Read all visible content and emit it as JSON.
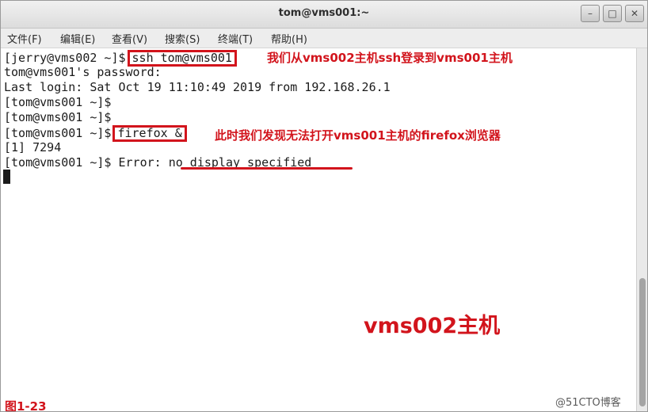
{
  "window": {
    "title": "tom@vms001:~",
    "min_glyph": "–",
    "max_glyph": "□",
    "close_glyph": "✕"
  },
  "menu": {
    "items": [
      "文件(F)",
      "编辑(E)",
      "查看(V)",
      "搜索(S)",
      "终端(T)",
      "帮助(H)"
    ]
  },
  "terminal": {
    "line1_prompt": "[jerry@vms002 ~]$",
    "line1_cmd": "ssh tom@vms001",
    "line2": "tom@vms001's password:",
    "line3": "Last login: Sat Oct 19 11:10:49 2019 from 192.168.26.1",
    "line4": "[tom@vms001 ~]$",
    "line5": "[tom@vms001 ~]$",
    "line6_prompt": "[tom@vms001 ~]$",
    "line6_cmd": "firefox &",
    "line7": "[1] 7294",
    "line8_prompt": "[tom@vms001 ~]$ Error: ",
    "line8_error": "no display specified"
  },
  "annotations": {
    "ssh_note": "我们从vms002主机ssh登录到vms001主机",
    "firefox_note": "此时我们发现无法打开vms001主机的firefox浏览器",
    "host_label": "vms002主机",
    "figure_label": "图1-23",
    "watermark": "@51CTO博客"
  },
  "colors": {
    "annotation": "#d2141c",
    "terminal_fg": "#1b1b1b",
    "terminal_bg": "#ffffff"
  }
}
